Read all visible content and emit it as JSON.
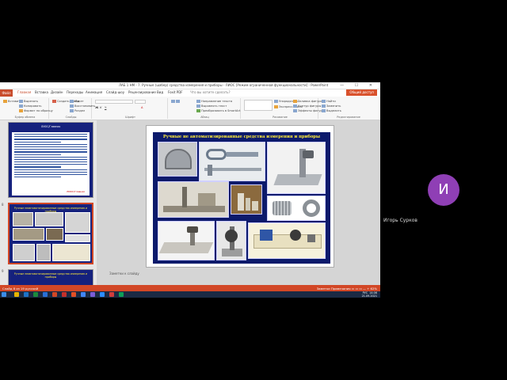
{
  "window": {
    "title": "ЛАБ 1 НМ - 7. Ручные (шабер) средства измерения и приборы - ЛИОС [Режим ограниченной функциональности] - PowerPoint",
    "controls": "— ☐ ✕"
  },
  "ribbon": {
    "file_tab": "Файл",
    "tabs": [
      "Главная",
      "Вставка",
      "Дизайн",
      "Переходы",
      "Анимация",
      "Слайд-шоу",
      "Рецензирование",
      "Вид",
      "Foxit PDF"
    ],
    "search_placeholder": "Что вы хотите сделать?",
    "account": "Общий доступ",
    "groups": {
      "clipboard": {
        "label": "Буфер обмена",
        "paste": "Вставить",
        "cut": "Вырезать",
        "copy": "Копировать",
        "format": "Формат по образцу"
      },
      "slides": {
        "label": "Слайды",
        "new_slide": "Создать слайд",
        "layout": "Макет",
        "reset": "Восстановить",
        "section": "Раздел"
      },
      "font": {
        "label": "Шрифт"
      },
      "paragraph": {
        "label": "Абзац",
        "text_direction": "Направление текста",
        "align_text": "Выровнять текст",
        "smartart": "Преобразовать в SmartArt"
      },
      "drawing": {
        "label": "Рисование",
        "arrange": "Упорядочить",
        "quick_styles": "Экспресс-стили",
        "fill": "Заливка фигуры",
        "outline": "Контур фигуры",
        "effects": "Эффекты фигуры"
      },
      "editing": {
        "label": "Редактирование",
        "find": "Найти",
        "replace": "Заменить",
        "select": "Выделить"
      }
    }
  },
  "slides_pane": {
    "thumb1": {
      "title": "ЛИОС/Главная"
    },
    "thumb2": {
      "number": "8",
      "title": "Ручные неавтоматизированные средства измерения и приборы"
    },
    "thumb3": {
      "number": "9",
      "title": "Ручные неавтоматизированные средства измерения и приборы"
    },
    "thumb1_link": "ЛИОС/Главная"
  },
  "slide": {
    "title": "Ручные не автоматизированные средства измерения и приборы",
    "notes_placeholder": "Заметки к слайду"
  },
  "statusbar": {
    "left": "Слайд 8 из 19   русский",
    "right": "Заметки   Примечания   ▭ ▭ ▭   —   + 62%"
  },
  "taskbar": {
    "lang": "РУС",
    "time": "14:06",
    "date": "21.09.2021"
  },
  "participant": {
    "initial": "И",
    "name": "Игорь Сурков"
  },
  "colors": {
    "accent": "#d24726",
    "slide_bg": "#0c1a6b",
    "title_yellow": "#ffeb3b",
    "avatar": "#8f3fb5"
  }
}
